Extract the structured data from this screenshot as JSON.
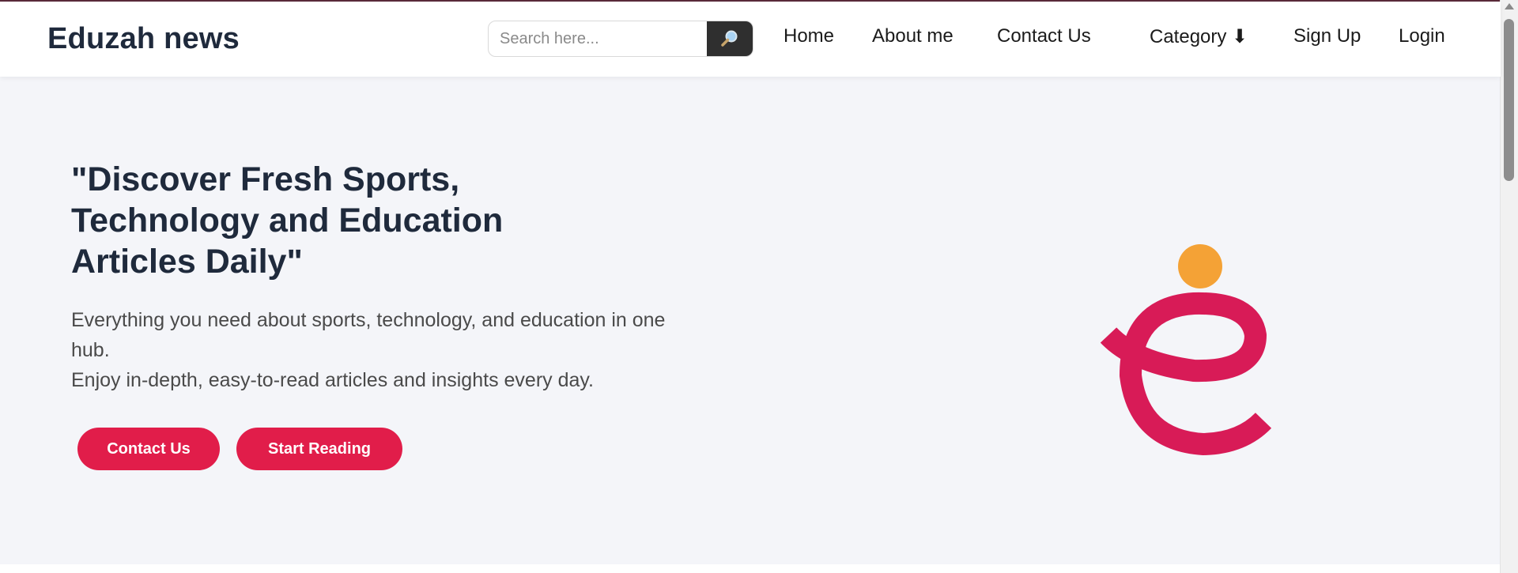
{
  "navbar": {
    "brand": "Eduzah news",
    "search": {
      "placeholder": "Search here...",
      "value": "",
      "button_icon": "magnifier-icon"
    },
    "links": [
      "Home",
      "About me",
      "Contact Us",
      "Category ⬇",
      "Sign Up",
      "Login"
    ]
  },
  "hero": {
    "title": "\"Discover Fresh Sports, Technology and Education Articles Daily\"",
    "description_line1": "Everything you need about sports, technology, and education in one hub.",
    "description_line2": "Enjoy in-depth, easy-to-read articles and insights every day.",
    "buttons": {
      "contact": "Contact Us",
      "start": "Start Reading"
    }
  },
  "colors": {
    "brand_text": "#1f2a3c",
    "accent": "#e11d4a",
    "hero_bg": "#f4f5f9",
    "logo_magenta": "#d81b57",
    "logo_orange": "#f4a236",
    "search_button": "#2f2f2f"
  },
  "logo_icon": "eduzah-e-logo-icon"
}
